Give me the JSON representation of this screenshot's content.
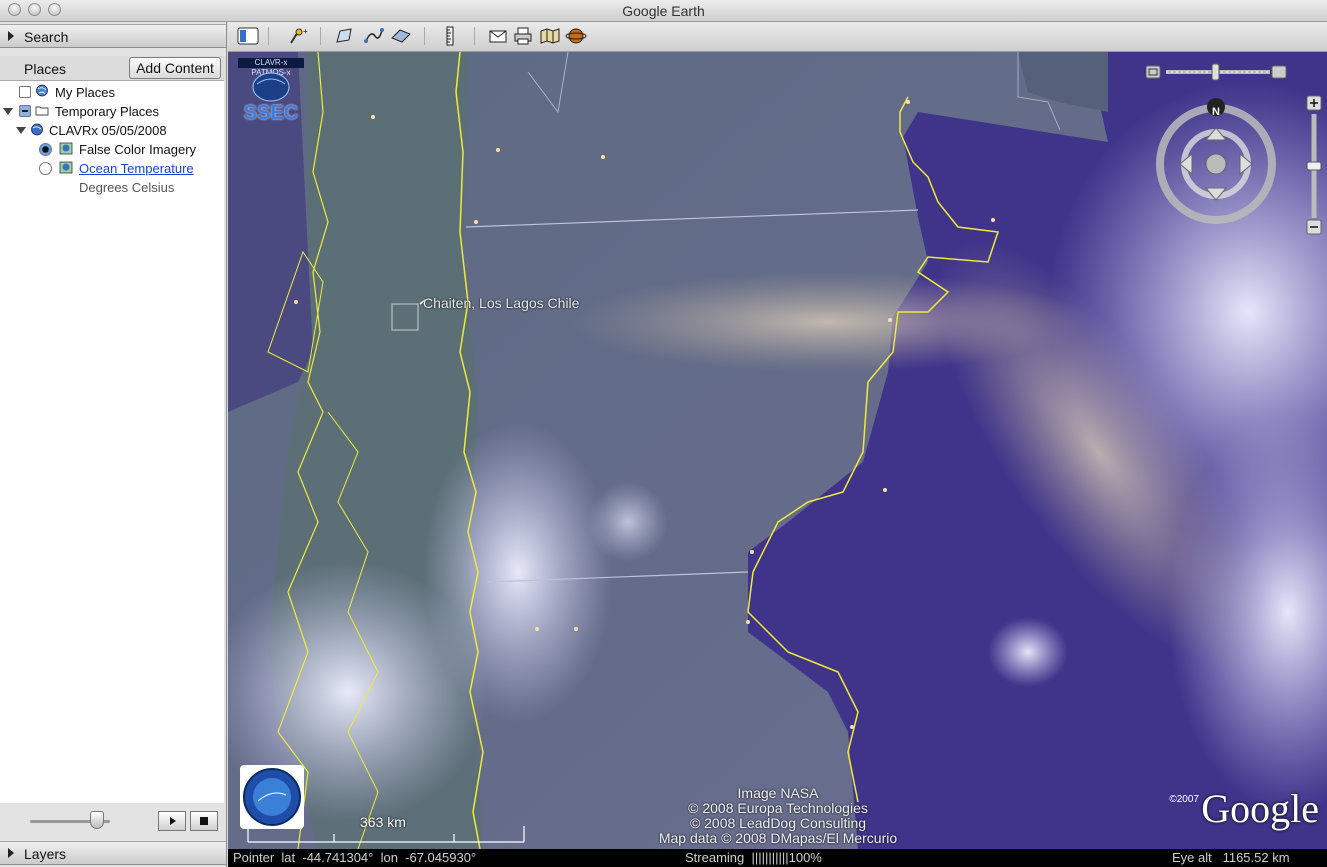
{
  "window": {
    "title": "Google Earth"
  },
  "sidebar": {
    "search_label": "Search",
    "places_label": "Places",
    "add_content_label": "Add Content",
    "layers_label": "Layers",
    "tree": {
      "my_places": "My Places",
      "temporary_places": "Temporary Places",
      "clavrx": "CLAVRx 05/05/2008",
      "false_color": "False Color Imagery",
      "ocean_temp": "Ocean Temperature",
      "ocean_desc": "Degrees Celsius"
    }
  },
  "map": {
    "logo_text": "SSEC",
    "logo_banner": "CLAVR-x PATMOS-x",
    "placemark_label": "Chaiten, Los Lagos Chile",
    "credits": [
      "Image NASA",
      "© 2008 Europa Technologies",
      "© 2008 LeadDog Consulting",
      "Map data © 2008 DMapas/El Mercurio"
    ],
    "google_logo": "Google",
    "google_year": "©2007",
    "scale_label": "363 km",
    "compass_north": "N"
  },
  "status": {
    "pointer": "Pointer  lat  -44.741304°  lon  -67.045930°",
    "streaming": "Streaming  |||||||||||100%",
    "eye_alt": "Eye alt   1165.52 km"
  },
  "colors": {
    "ocean": "#3f348a",
    "land": "#6a6e90",
    "border": "#f0ea3a"
  }
}
